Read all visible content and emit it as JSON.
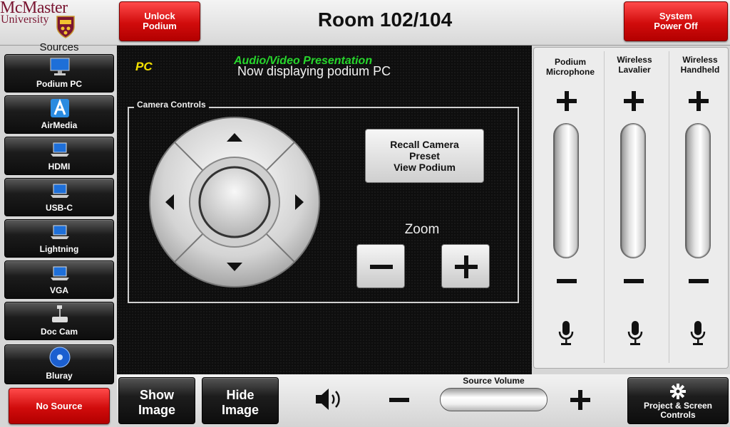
{
  "header": {
    "logo_line1": "McMaster",
    "logo_line2": "University",
    "unlock_label_1": "Unlock",
    "unlock_label_2": "Podium",
    "room_title": "Room 102/104",
    "power_label_1": "System",
    "power_label_2": "Power Off"
  },
  "sidebar": {
    "title": "Sources",
    "items": [
      {
        "label": "Podium PC",
        "icon": "monitor-icon"
      },
      {
        "label": "AirMedia",
        "icon": "airmedia-icon"
      },
      {
        "label": "HDMI",
        "icon": "laptop-icon"
      },
      {
        "label": "USB-C",
        "icon": "laptop-icon"
      },
      {
        "label": "Lightning",
        "icon": "laptop-icon"
      },
      {
        "label": "VGA",
        "icon": "laptop-icon"
      },
      {
        "label": "Doc Cam",
        "icon": "document-camera-icon"
      },
      {
        "label": "Bluray",
        "icon": "bluray-icon"
      }
    ],
    "no_source_label": "No Source"
  },
  "main": {
    "source_tag": "PC",
    "mode_label": "Audio/Video Presentation",
    "status_text": "Now displaying podium PC",
    "camera": {
      "legend": "Camera Controls",
      "recall_line1": "Recall Camera",
      "recall_line2": "Preset",
      "recall_line3": "View Podium",
      "zoom_label": "Zoom"
    }
  },
  "audio": {
    "channels": [
      {
        "line1": "Podium",
        "line2": "Microphone"
      },
      {
        "line1": "Wireless",
        "line2": "Lavalier"
      },
      {
        "line1": "Wireless",
        "line2": "Handheld"
      }
    ]
  },
  "bottom": {
    "show_image_1": "Show",
    "show_image_2": "Image",
    "hide_image_1": "Hide",
    "hide_image_2": "Image",
    "source_volume_label": "Source Volume",
    "project_label_1": "Project & Screen",
    "project_label_2": "Controls"
  },
  "colors": {
    "accent_red": "#d10c0c",
    "status_green": "#27d62c",
    "source_yellow": "#f5e200",
    "brand_maroon": "#7a1632"
  }
}
